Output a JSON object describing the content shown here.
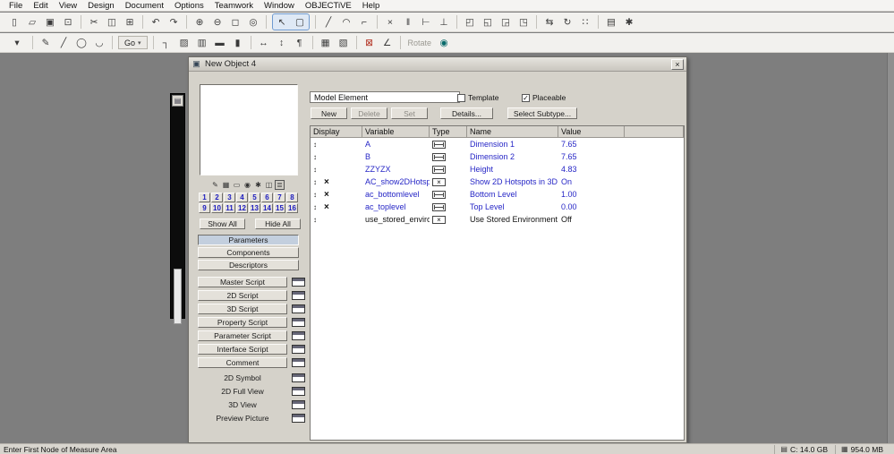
{
  "menu": {
    "items": [
      "File",
      "Edit",
      "View",
      "Design",
      "Document",
      "Options",
      "Teamwork",
      "Window",
      "OBJECTiVE",
      "Help"
    ]
  },
  "toolbar1": {
    "icons": [
      {
        "name": "new-icon",
        "glyph": "▯"
      },
      {
        "name": "open-icon",
        "glyph": "▱"
      },
      {
        "name": "save-icon",
        "glyph": "▣"
      },
      {
        "name": "print-icon",
        "glyph": "⊡"
      },
      {
        "name": "cut-icon",
        "glyph": "✂"
      },
      {
        "name": "copy-icon",
        "glyph": "◫"
      },
      {
        "name": "paste-icon",
        "glyph": "⊞"
      },
      {
        "name": "undo-icon",
        "glyph": "↶"
      },
      {
        "name": "redo-icon",
        "glyph": "↷"
      },
      {
        "name": "zoom-in-icon",
        "glyph": "⊕"
      },
      {
        "name": "zoom-out-icon",
        "glyph": "⊖"
      },
      {
        "name": "zoom-fit-icon",
        "glyph": "◻"
      },
      {
        "name": "pan-icon",
        "glyph": "◎"
      },
      {
        "name": "arrow-tool-icon",
        "glyph": "↖"
      },
      {
        "name": "marquee-tool-icon",
        "glyph": "▢"
      },
      {
        "name": "line-tool-icon",
        "glyph": "╱"
      },
      {
        "name": "arc-tool-icon",
        "glyph": "◠"
      },
      {
        "name": "polyline-tool-icon",
        "glyph": "⌐"
      },
      {
        "name": "trim-icon",
        "glyph": "×"
      },
      {
        "name": "split-icon",
        "glyph": "‖"
      },
      {
        "name": "adjust-icon",
        "glyph": "⊢"
      },
      {
        "name": "intersect-icon",
        "glyph": "⊥"
      },
      {
        "name": "group-icon",
        "glyph": "◰"
      },
      {
        "name": "ungroup-icon",
        "glyph": "◱"
      },
      {
        "name": "bring-forward-icon",
        "glyph": "◲"
      },
      {
        "name": "send-backward-icon",
        "glyph": "◳"
      },
      {
        "name": "mirror-icon",
        "glyph": "⇆"
      },
      {
        "name": "rotate-icon",
        "glyph": "↻"
      },
      {
        "name": "multiply-icon",
        "glyph": "∷"
      },
      {
        "name": "layers-icon",
        "glyph": "▤"
      },
      {
        "name": "settings-icon",
        "glyph": "✱"
      }
    ]
  },
  "toolbar2": {
    "icons": [
      {
        "name": "favorites-dropdown-icon",
        "glyph": "▾"
      },
      {
        "name": "pen-icon",
        "glyph": "✎"
      },
      {
        "name": "line-icon",
        "glyph": "╱"
      },
      {
        "name": "circle-icon",
        "glyph": "◯"
      },
      {
        "name": "arc-icon",
        "glyph": "◡"
      },
      {
        "name": "corner-icon",
        "glyph": "┐"
      },
      {
        "name": "hatch-icon",
        "glyph": "▨"
      },
      {
        "name": "wall-icon",
        "glyph": "▥"
      },
      {
        "name": "beam-icon",
        "glyph": "▬"
      },
      {
        "name": "column-icon",
        "glyph": "▮"
      },
      {
        "name": "dimension-icon",
        "glyph": "↔"
      },
      {
        "name": "level-dimension-icon",
        "glyph": "↕"
      },
      {
        "name": "label-icon",
        "glyph": "¶"
      },
      {
        "name": "fill-icon",
        "glyph": "▦"
      },
      {
        "name": "zone-icon",
        "glyph": "▧"
      },
      {
        "name": "paint-icon",
        "glyph": "⊠"
      },
      {
        "name": "angle-icon",
        "glyph": "∠"
      },
      {
        "name": "publish-icon",
        "glyph": "◉"
      }
    ],
    "go": {
      "label": "Go",
      "arrow": "▾"
    },
    "rotate_label": "Rotate"
  },
  "palette": {
    "head_glyph": "▤"
  },
  "dialog": {
    "title": "New Object 4",
    "icon_glyph": "▣",
    "close_glyph": "×",
    "subtype_value": "Model Element",
    "template_label": "Template",
    "placeable_label": "Placeable",
    "check_glyph": "✓",
    "actions": {
      "new": "New",
      "delete": "Delete",
      "set": "Set",
      "details": "Details...",
      "select_subtype": "Select Subtype..."
    },
    "left": {
      "preview_icons": [
        {
          "name": "2d-symbol-preview-icon",
          "glyph": "✎"
        },
        {
          "name": "2d-view-preview-icon",
          "glyph": "▦"
        },
        {
          "name": "3d-view-preview-icon",
          "glyph": "▭"
        },
        {
          "name": "photo-preview-icon",
          "glyph": "◉"
        },
        {
          "name": "settings-preview-icon",
          "glyph": "✱"
        },
        {
          "name": "picture-preview-icon",
          "glyph": "◫"
        },
        {
          "name": "info-preview-icon",
          "glyph": "≣"
        }
      ],
      "numbers": [
        "1",
        "2",
        "3",
        "4",
        "5",
        "6",
        "7",
        "8",
        "9",
        "10",
        "11",
        "12",
        "13",
        "14",
        "15",
        "16"
      ],
      "show_all": "Show All",
      "hide_all": "Hide All",
      "sections": [
        "Parameters",
        "Components",
        "Descriptors"
      ],
      "scripts": [
        "Master Script",
        "2D Script",
        "3D Script",
        "Property Script",
        "Parameter Script",
        "Interface Script",
        "Comment"
      ],
      "views": [
        "2D Symbol",
        "2D Full View",
        "3D View",
        "Preview Picture"
      ]
    },
    "table": {
      "headers": [
        "Display",
        "Variable",
        "Type",
        "Name",
        "Value"
      ],
      "row_handle_glyph": "↕",
      "bool_glyph": "×",
      "rows": [
        {
          "x_mark": "",
          "variable": "A",
          "type": "length",
          "name": "Dimension 1",
          "value": "7.65"
        },
        {
          "x_mark": "",
          "variable": "B",
          "type": "length",
          "name": "Dimension 2",
          "value": "7.65"
        },
        {
          "x_mark": "",
          "variable": "ZZYZX",
          "type": "length",
          "name": "Height",
          "value": "4.83"
        },
        {
          "x_mark": "×",
          "variable": "AC_show2DHotsp...",
          "type": "boolean",
          "name": "Show 2D Hotspots in 3D",
          "value": "On"
        },
        {
          "x_mark": "×",
          "variable": "ac_bottomlevel",
          "type": "length",
          "name": "Bottom Level",
          "value": "1.00"
        },
        {
          "x_mark": "×",
          "variable": "ac_toplevel",
          "type": "length",
          "name": "Top Level",
          "value": "0.00"
        },
        {
          "x_mark": "",
          "variable": "use_stored_enviro...",
          "type": "boolean",
          "name": "Use Stored Environment",
          "value": "Off"
        }
      ]
    }
  },
  "statusbar": {
    "hint": "Enter First Node of Measure Area",
    "disk_icon": "▤",
    "disk": "C: 14.0 GB",
    "memory_icon": "▦",
    "memory": "954.0 MB"
  }
}
